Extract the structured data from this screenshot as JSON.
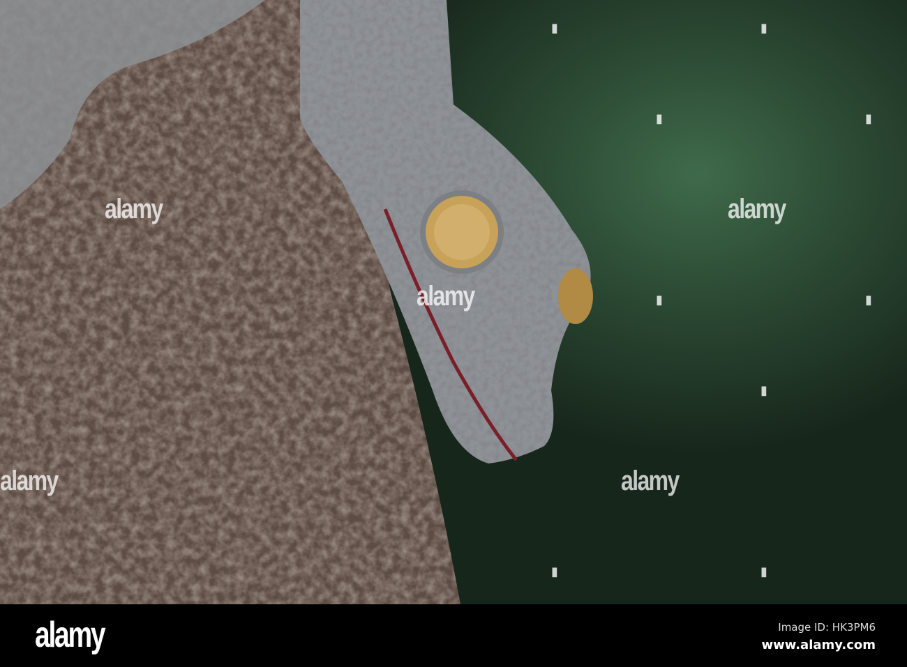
{
  "watermark": {
    "text": "alamy"
  },
  "footer": {
    "logo": "alamy",
    "image_id": "Image ID: HK3PM6",
    "url": "www.alamy.com"
  },
  "colors": {
    "bark": "#5a4a42",
    "background_green": "#2c4a34",
    "gecko": "#8a8e92",
    "eye": "#c9a25a",
    "tongue": "#7a1f2a"
  }
}
